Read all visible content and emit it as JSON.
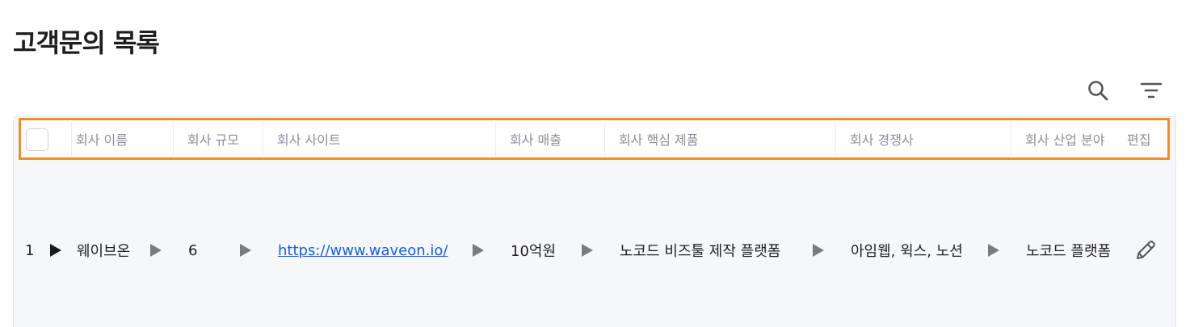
{
  "page": {
    "title": "고객문의 목록"
  },
  "icons": {
    "search": "search-icon",
    "filter": "filter-icon",
    "expand": "triangle-right-icon",
    "edit": "pencil-icon"
  },
  "colors": {
    "highlight": "#f28c28",
    "link": "#1a5fd6",
    "table_bg": "#f6f7fb",
    "header_text": "#8a8f99"
  },
  "table": {
    "columns": [
      {
        "key": "name",
        "label": "회사 이름"
      },
      {
        "key": "size",
        "label": "회사 규모"
      },
      {
        "key": "site",
        "label": "회사 사이트"
      },
      {
        "key": "revenue",
        "label": "회사 매출"
      },
      {
        "key": "product",
        "label": "회사 핵심 제품"
      },
      {
        "key": "competitors",
        "label": "회사 경쟁사"
      },
      {
        "key": "industry",
        "label": "회사 산업 분야"
      },
      {
        "key": "edit",
        "label": "편집"
      }
    ],
    "rows": [
      {
        "index": "1",
        "name": "웨이브온",
        "size": "6",
        "site": "https://www.waveon.io/",
        "revenue": "10억원",
        "product": "노코드 비즈툴 제작 플랫폼",
        "competitors": "아임웹, 윅스, 노션",
        "industry": "노코드 플랫폼"
      }
    ]
  }
}
